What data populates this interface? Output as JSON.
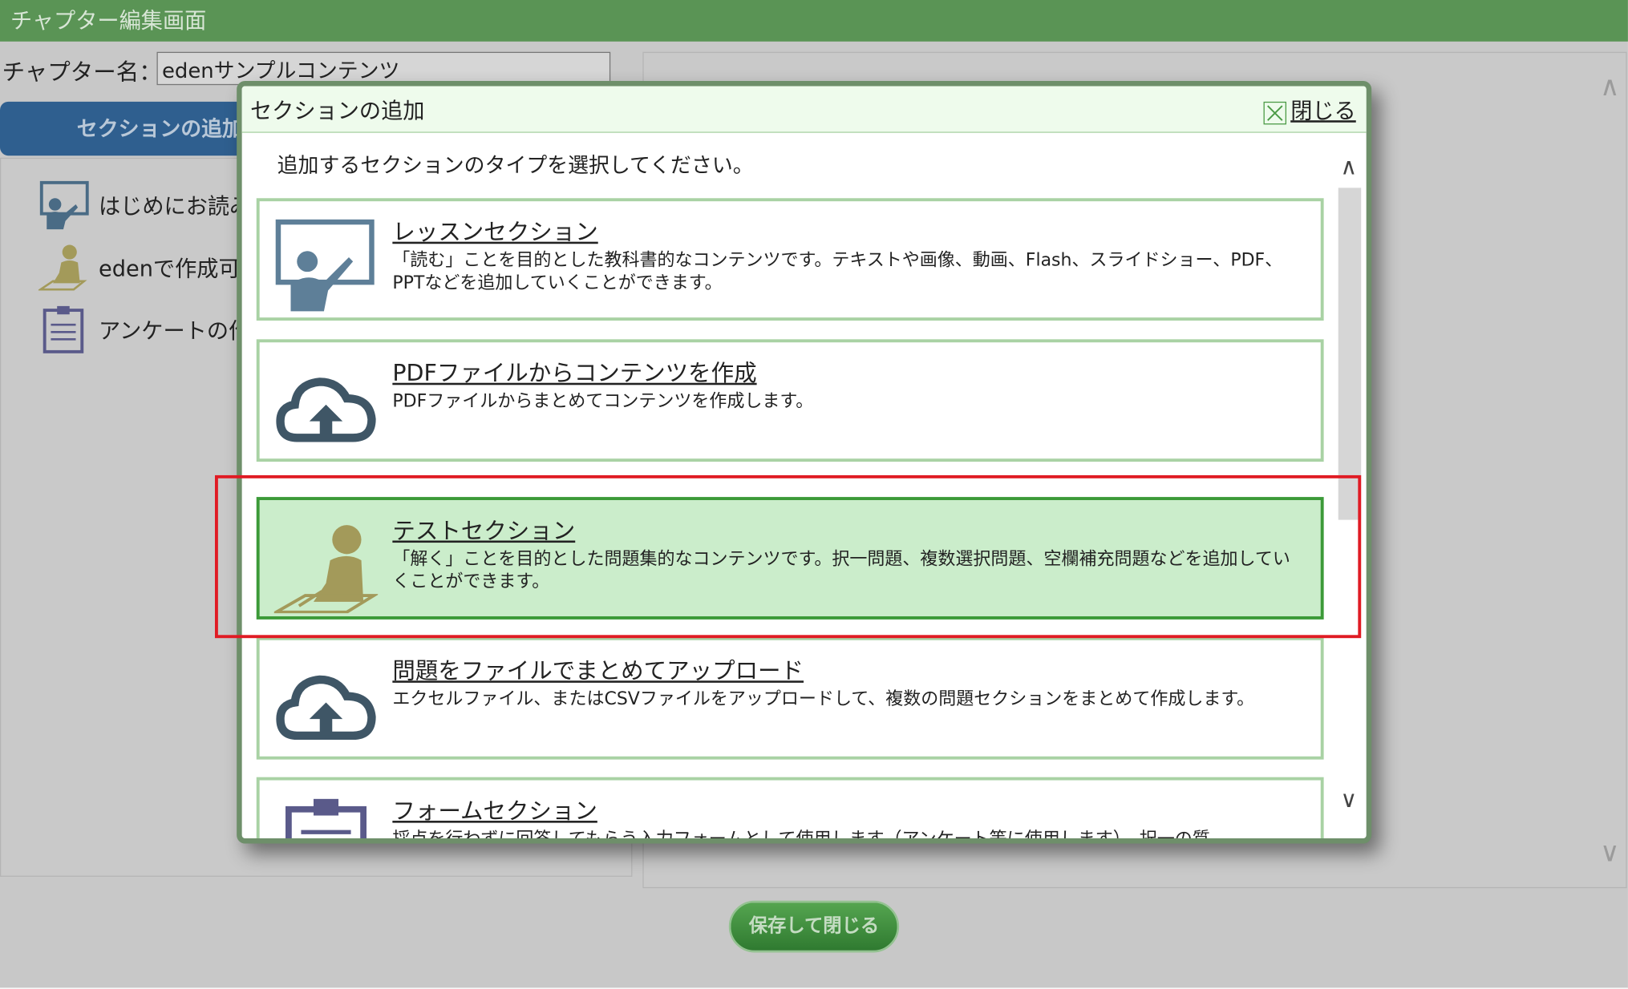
{
  "window": {
    "title": "チャプター編集画面"
  },
  "chapter": {
    "label": "チャプター名：",
    "name_value": "edenサンプルコンテンツ"
  },
  "left": {
    "add_section_button": "セクションの追加",
    "tree": [
      {
        "label": "はじめにお読み",
        "icon": "lesson-icon"
      },
      {
        "label": "edenで作成可",
        "icon": "test-icon"
      },
      {
        "label": "アンケートの作",
        "icon": "form-icon"
      }
    ]
  },
  "footer": {
    "save_close": "保存して閉じる"
  },
  "modal": {
    "title": "セクションの追加",
    "close_label": "閉じる",
    "instruction": "追加するセクションのタイプを選択してください。",
    "items": [
      {
        "title": "レッスンセクション",
        "desc": "「読む」ことを目的とした教科書的なコンテンツです。テキストや画像、動画、Flash、スライドショー、PDF、PPTなどを追加していくことができます。",
        "icon": "teacher-board-icon"
      },
      {
        "title": "PDFファイルからコンテンツを作成",
        "desc": "PDFファイルからまとめてコンテンツを作成します。",
        "icon": "cloud-upload-icon"
      },
      {
        "title": "テストセクション",
        "desc": "「解く」ことを目的とした問題集的なコンテンツです。択一問題、複数選択問題、空欄補充問題などを追加していくことができます。",
        "icon": "student-writing-icon"
      },
      {
        "title": "問題をファイルでまとめてアップロード",
        "desc": "エクセルファイル、またはCSVファイルをアップロードして、複数の問題セクションをまとめて作成します。",
        "icon": "cloud-upload-icon"
      },
      {
        "title": "フォームセクション",
        "desc": "採点を行わずに回答してもらう入力フォームとして使用します（アンケート等に使用します）。択一の質",
        "icon": "clipboard-icon"
      }
    ],
    "selected_index": 2
  }
}
